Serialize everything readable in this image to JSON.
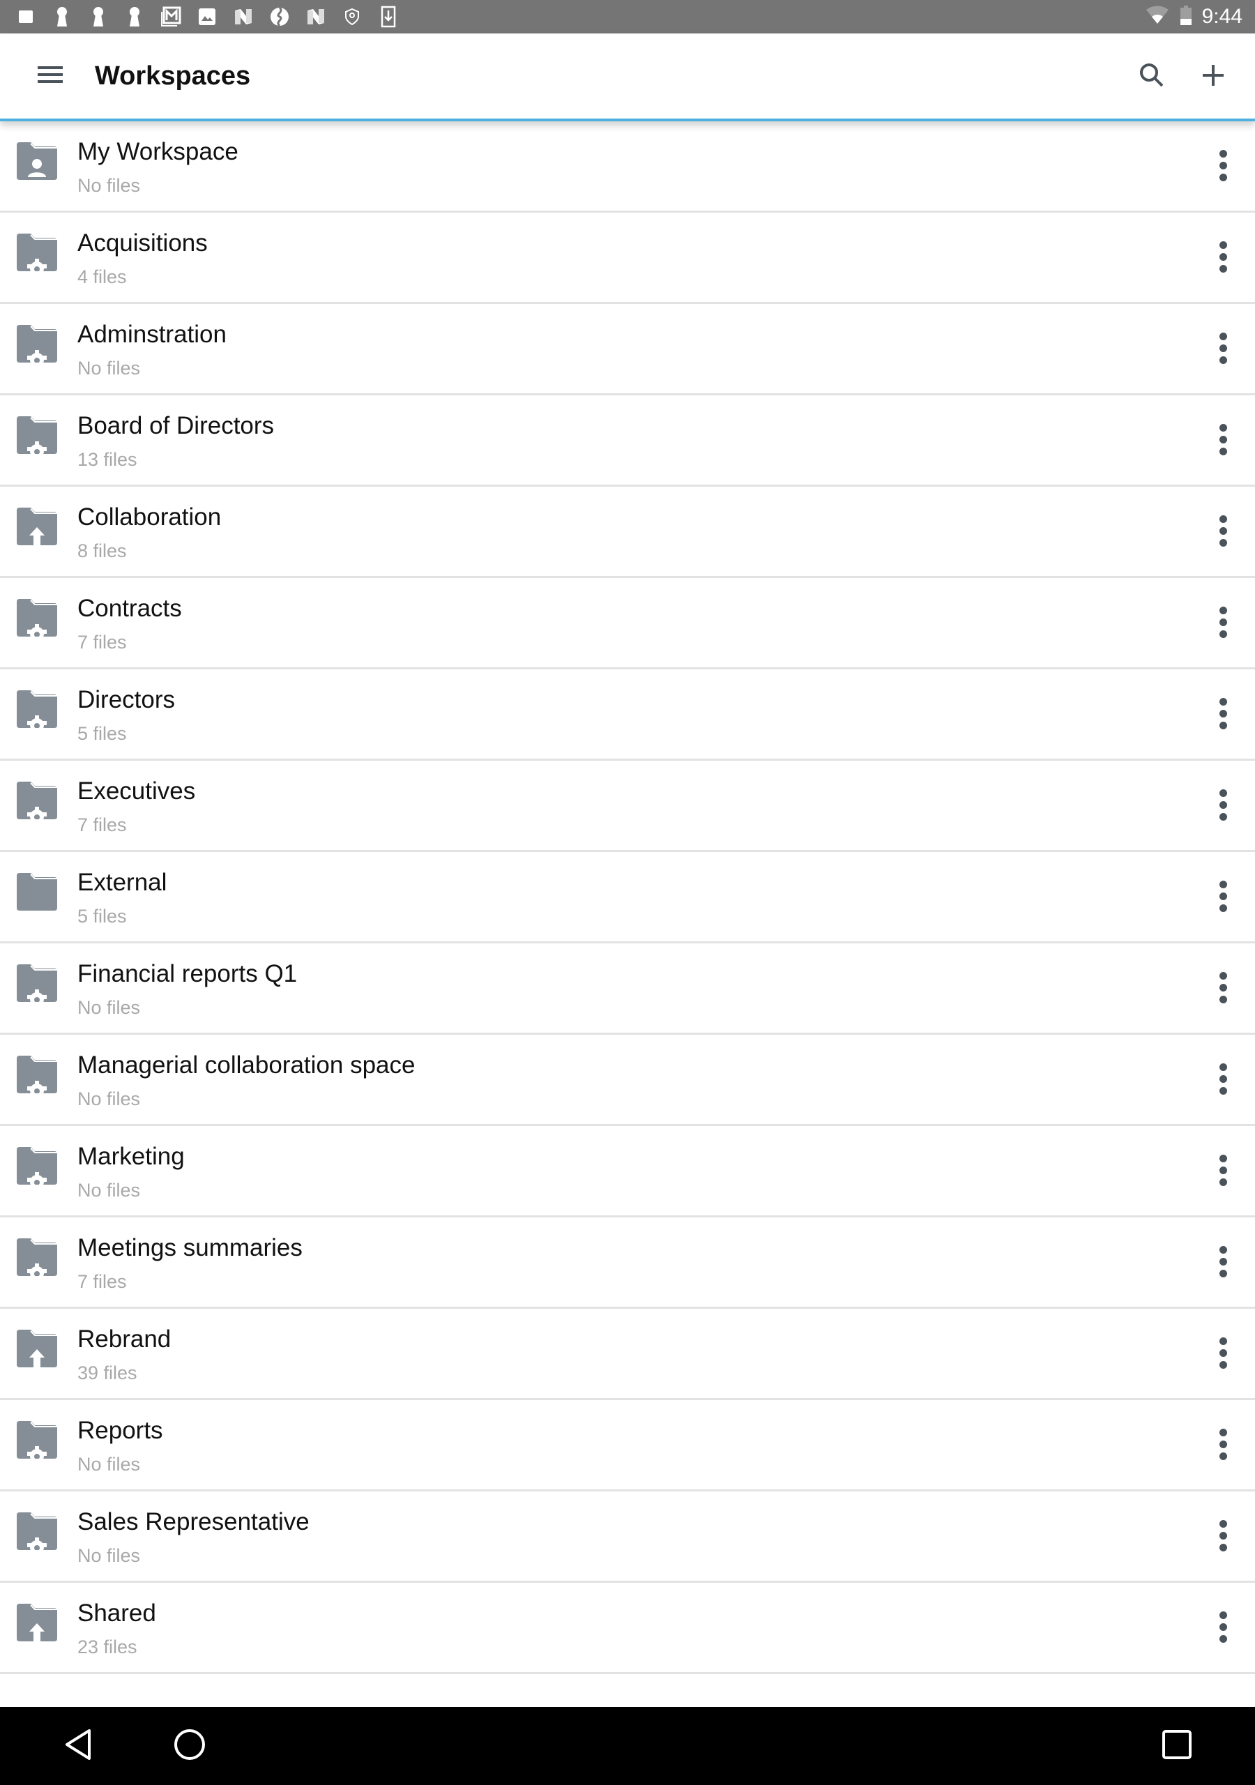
{
  "status_bar": {
    "time": "9:44",
    "notification_icons": [
      "square-icon",
      "keyhole-icon",
      "keyhole-icon",
      "keyhole-icon",
      "gmail-icon",
      "photo-icon",
      "n-icon",
      "swirl-icon",
      "n-icon",
      "shield-icon",
      "download-icon"
    ],
    "wifi": "wifi-icon",
    "battery": "battery-icon"
  },
  "app_bar": {
    "title": "Workspaces",
    "menu_icon": "hamburger-menu-icon",
    "search_icon": "search-icon",
    "add_icon": "add-icon",
    "accent_color": "#4fb0e0"
  },
  "workspaces": [
    {
      "name": "My Workspace",
      "files": "No files",
      "icon": "personal-folder-icon"
    },
    {
      "name": "Acquisitions",
      "files": "4 files",
      "icon": "settings-folder-icon"
    },
    {
      "name": "Adminstration",
      "files": "No files",
      "icon": "settings-folder-icon"
    },
    {
      "name": "Board of Directors",
      "files": "13 files",
      "icon": "settings-folder-icon"
    },
    {
      "name": "Collaboration",
      "files": "8 files",
      "icon": "upload-folder-icon"
    },
    {
      "name": "Contracts",
      "files": "7 files",
      "icon": "settings-folder-icon"
    },
    {
      "name": "Directors",
      "files": "5 files",
      "icon": "settings-folder-icon"
    },
    {
      "name": "Executives",
      "files": "7 files",
      "icon": "settings-folder-icon"
    },
    {
      "name": "External",
      "files": "5 files",
      "icon": "folder-icon"
    },
    {
      "name": "Financial reports Q1",
      "files": "No files",
      "icon": "settings-folder-icon"
    },
    {
      "name": "Managerial collaboration space",
      "files": "No files",
      "icon": "settings-folder-icon"
    },
    {
      "name": "Marketing",
      "files": "No files",
      "icon": "settings-folder-icon"
    },
    {
      "name": "Meetings summaries",
      "files": "7 files",
      "icon": "settings-folder-icon"
    },
    {
      "name": "Rebrand",
      "files": "39 files",
      "icon": "upload-folder-icon"
    },
    {
      "name": "Reports",
      "files": "No files",
      "icon": "settings-folder-icon"
    },
    {
      "name": "Sales Representative",
      "files": "No files",
      "icon": "settings-folder-icon"
    },
    {
      "name": "Shared",
      "files": "23 files",
      "icon": "upload-folder-icon"
    }
  ],
  "nav_bar": {
    "back": "back-icon",
    "home": "home-icon",
    "recents": "recents-icon"
  }
}
